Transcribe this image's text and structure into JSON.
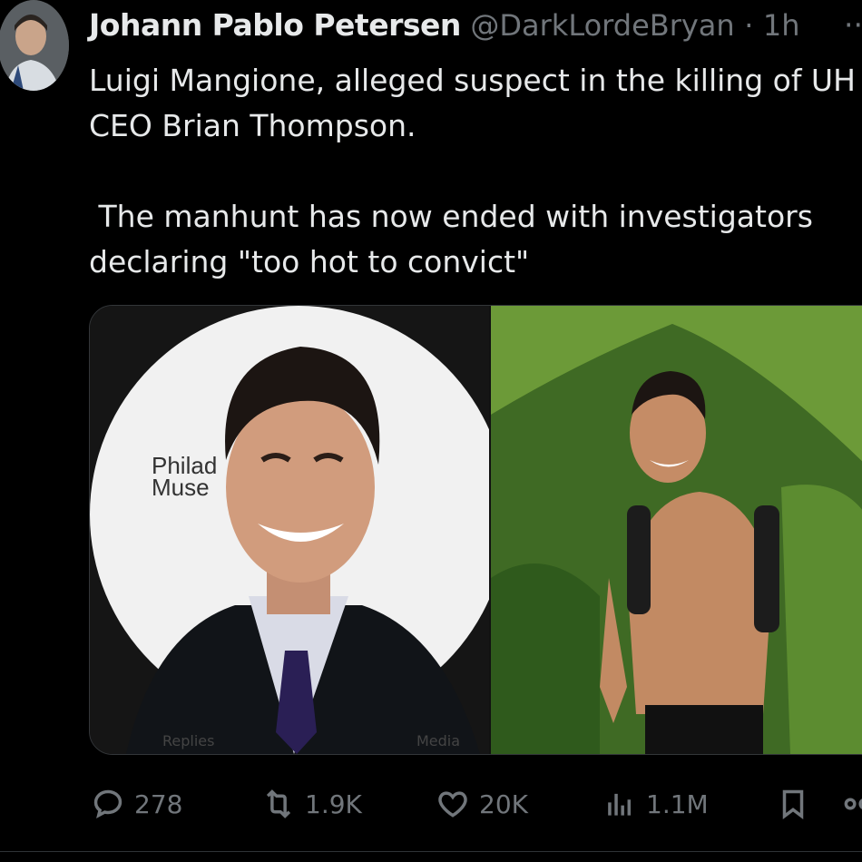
{
  "author": {
    "name": "Johann Pablo Petersen",
    "handle": "@DarkLordeBryan",
    "separator": "·",
    "time": "1h",
    "more_icon": "more-icon"
  },
  "tweet": {
    "text": "Luigi Mangione, alleged suspect in the killing of UH\nCEO Brian Thompson.\n\n The manhunt has now ended with investigators\ndeclaring \"too hot to convict\""
  },
  "media": {
    "left_image_sign_text": "Philad\nMuse",
    "left_image_caption_a": "Replies",
    "left_image_caption_b": "Media"
  },
  "actions": {
    "replies": "278",
    "reposts": "1.9K",
    "likes": "20K",
    "views": "1.1M"
  }
}
